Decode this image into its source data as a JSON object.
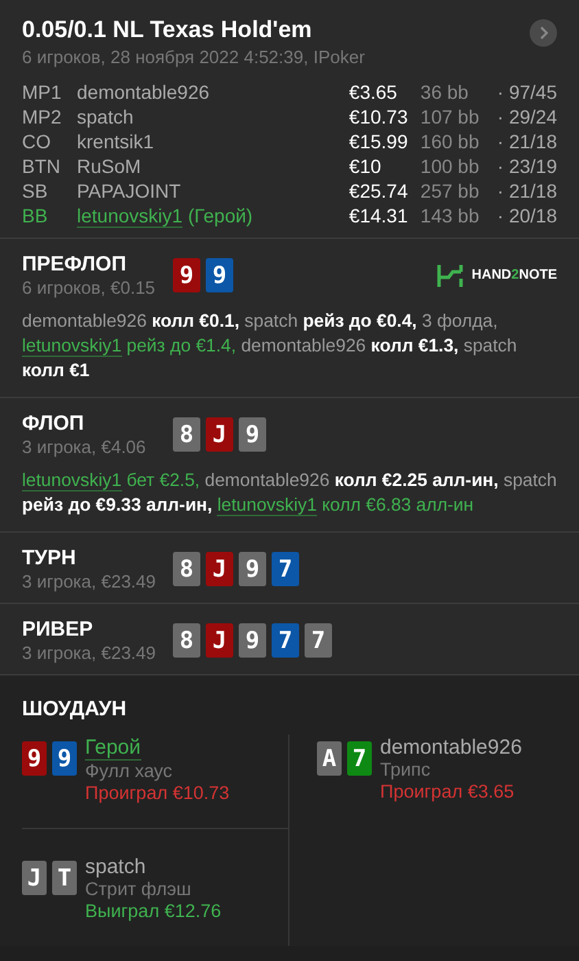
{
  "header": {
    "title": "0.05/0.1 NL Texas Hold'em",
    "subtitle": "6 игроков, 28 ноября 2022 4:52:39, IPoker"
  },
  "players": [
    {
      "position": "MP1",
      "name": "demontable926",
      "hero": false,
      "stack": "€3.65",
      "bb": "36 bb",
      "stats": "· 97/45"
    },
    {
      "position": "MP2",
      "name": "spatch",
      "hero": false,
      "stack": "€10.73",
      "bb": "107 bb",
      "stats": "· 29/24"
    },
    {
      "position": "CO",
      "name": "krentsik1",
      "hero": false,
      "stack": "€15.99",
      "bb": "160 bb",
      "stats": "· 21/18"
    },
    {
      "position": "BTN",
      "name": "RuSoM",
      "hero": false,
      "stack": "€10",
      "bb": "100 bb",
      "stats": "· 23/19"
    },
    {
      "position": "SB",
      "name": "PAPAJOINT",
      "hero": false,
      "stack": "€25.74",
      "bb": "257 bb",
      "stats": "· 21/18"
    },
    {
      "position": "BB",
      "name": "letunovskiy1",
      "hero": true,
      "hero_tag": "(Герой)",
      "stack": "€14.31",
      "bb": "143 bb",
      "stats": "· 20/18"
    }
  ],
  "streets": [
    {
      "title": "ПРЕФЛОП",
      "subtitle": "6 игроков, €0.15",
      "logo_parts": [
        "HAND",
        "2",
        "NOTE"
      ],
      "cards": [
        {
          "rank": "9",
          "color": "#9c0b0b"
        },
        {
          "rank": "9",
          "color": "#0c57a8"
        }
      ],
      "actions": [
        {
          "kind": "player",
          "text": "demontable926"
        },
        {
          "kind": "action",
          "text": "колл €0.1,"
        },
        {
          "kind": "player",
          "text": "spatch"
        },
        {
          "kind": "action",
          "text": "рейз до €0.4,"
        },
        {
          "kind": "info",
          "text": "3 фолда,"
        },
        {
          "kind": "hero_player",
          "text": "letunovskiy1"
        },
        {
          "kind": "hero_action",
          "text": "рейз до €1.4,"
        },
        {
          "kind": "player",
          "text": "demontable926"
        },
        {
          "kind": "action",
          "text": "колл €1.3,"
        },
        {
          "kind": "player",
          "text": "spatch"
        },
        {
          "kind": "action",
          "text": "колл €1"
        }
      ]
    },
    {
      "title": "ФЛОП",
      "subtitle": "3 игрока, €4.06",
      "cards": [
        {
          "rank": "8",
          "color": "#6a6a6a"
        },
        {
          "rank": "J",
          "color": "#9c0b0b"
        },
        {
          "rank": "9",
          "color": "#6a6a6a"
        }
      ],
      "actions": [
        {
          "kind": "hero_player",
          "text": "letunovskiy1"
        },
        {
          "kind": "hero_action",
          "text": "бет €2.5,"
        },
        {
          "kind": "player",
          "text": "demontable926"
        },
        {
          "kind": "action",
          "text": "колл €2.25 алл-ин,"
        },
        {
          "kind": "player",
          "text": "spatch"
        },
        {
          "kind": "action",
          "text": "рейз до €9.33 алл-ин,"
        },
        {
          "kind": "hero_player",
          "text": "letunovskiy1"
        },
        {
          "kind": "hero_action",
          "text": "колл €6.83 алл-ин"
        }
      ]
    },
    {
      "title": "ТУРН",
      "subtitle": "3 игрока, €23.49",
      "cards": [
        {
          "rank": "8",
          "color": "#6a6a6a"
        },
        {
          "rank": "J",
          "color": "#9c0b0b"
        },
        {
          "rank": "9",
          "color": "#6a6a6a"
        },
        {
          "rank": "7",
          "color": "#0c57a8"
        }
      ]
    },
    {
      "title": "РИВЕР",
      "subtitle": "3 игрока, €23.49",
      "cards": [
        {
          "rank": "8",
          "color": "#6a6a6a"
        },
        {
          "rank": "J",
          "color": "#9c0b0b"
        },
        {
          "rank": "9",
          "color": "#6a6a6a"
        },
        {
          "rank": "7",
          "color": "#0c57a8"
        },
        {
          "rank": "7",
          "color": "#6a6a6a"
        }
      ]
    }
  ],
  "showdown": {
    "title": "ШОУДАУН",
    "entries": [
      {
        "name": "Герой",
        "hero": true,
        "hand": "Фулл хаус",
        "result": "Проиграл €10.73",
        "won": false,
        "cards": [
          {
            "rank": "9",
            "color": "#9c0b0b"
          },
          {
            "rank": "9",
            "color": "#0c57a8"
          }
        ]
      },
      {
        "name": "demontable926",
        "hero": false,
        "hand": "Трипс",
        "result": "Проиграл €3.65",
        "won": false,
        "cards": [
          {
            "rank": "A",
            "color": "#6a6a6a"
          },
          {
            "rank": "7",
            "color": "#0e8a14"
          }
        ]
      },
      {
        "name": "spatch",
        "hero": false,
        "hand": "Стрит флэш",
        "result": "Выиграл €12.76",
        "won": true,
        "cards": [
          {
            "rank": "J",
            "color": "#6a6a6a"
          },
          {
            "rank": "T",
            "color": "#6a6a6a"
          }
        ]
      }
    ]
  }
}
